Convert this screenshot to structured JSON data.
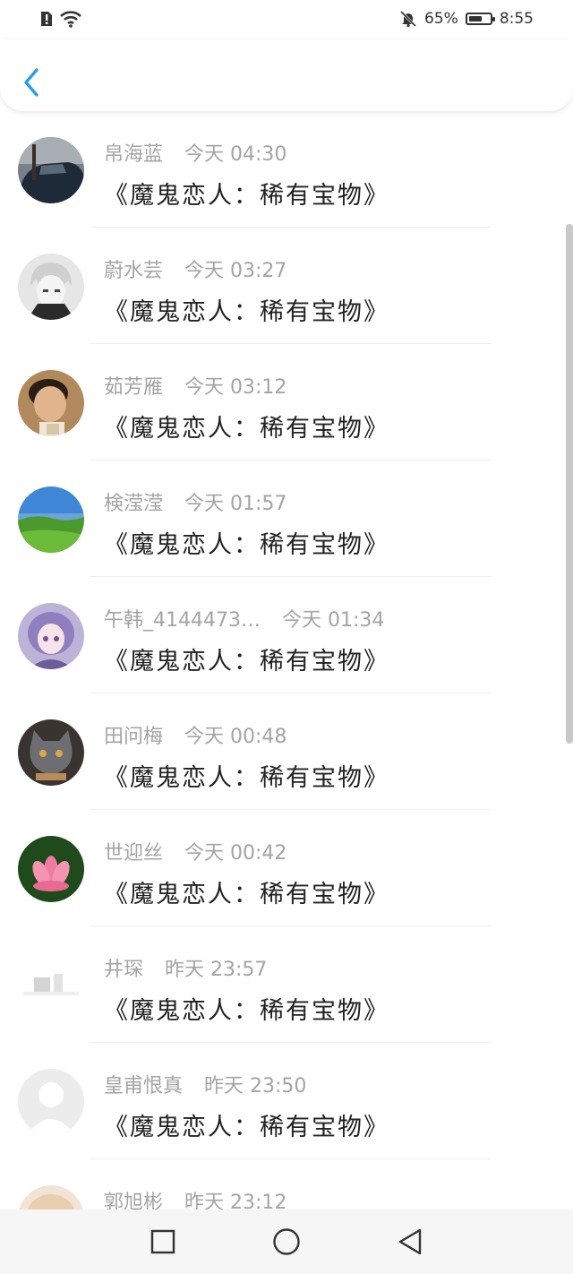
{
  "status_bar": {
    "battery_percent": "65%",
    "battery_level": 0.65,
    "time": "8:55"
  },
  "colors": {
    "accent": "#2a9cf0",
    "name_gray": "#a4a4a4",
    "message_text": "#222222"
  },
  "header": {
    "back_icon": "chevron-left-icon"
  },
  "list": {
    "items": [
      {
        "name": "帛海蓝",
        "time": "今天 04:30",
        "message": "《魔鬼恋人：稀有宝物》"
      },
      {
        "name": "蔚水芸",
        "time": "今天 03:27",
        "message": "《魔鬼恋人：稀有宝物》"
      },
      {
        "name": "茹芳雁",
        "time": "今天 03:12",
        "message": "《魔鬼恋人：稀有宝物》"
      },
      {
        "name": "検滢滢",
        "time": "今天 01:57",
        "message": "《魔鬼恋人：稀有宝物》"
      },
      {
        "name": "午韩_4144473…",
        "time": "今天 01:34",
        "message": "《魔鬼恋人：稀有宝物》"
      },
      {
        "name": "田问梅",
        "time": "今天 00:48",
        "message": "《魔鬼恋人：稀有宝物》"
      },
      {
        "name": "世迎丝",
        "time": "今天 00:42",
        "message": "《魔鬼恋人：稀有宝物》"
      },
      {
        "name": "井琛",
        "time": "昨天 23:57",
        "message": "《魔鬼恋人：稀有宝物》"
      },
      {
        "name": "皇甫恨真",
        "time": "昨天 23:50",
        "message": "《魔鬼恋人：稀有宝物》"
      },
      {
        "name": "郭旭彬",
        "time": "昨天 23:12",
        "message": ""
      }
    ]
  },
  "nav_bar": {
    "icons": [
      "recent-apps-icon",
      "home-icon",
      "back-triangle-icon"
    ]
  }
}
